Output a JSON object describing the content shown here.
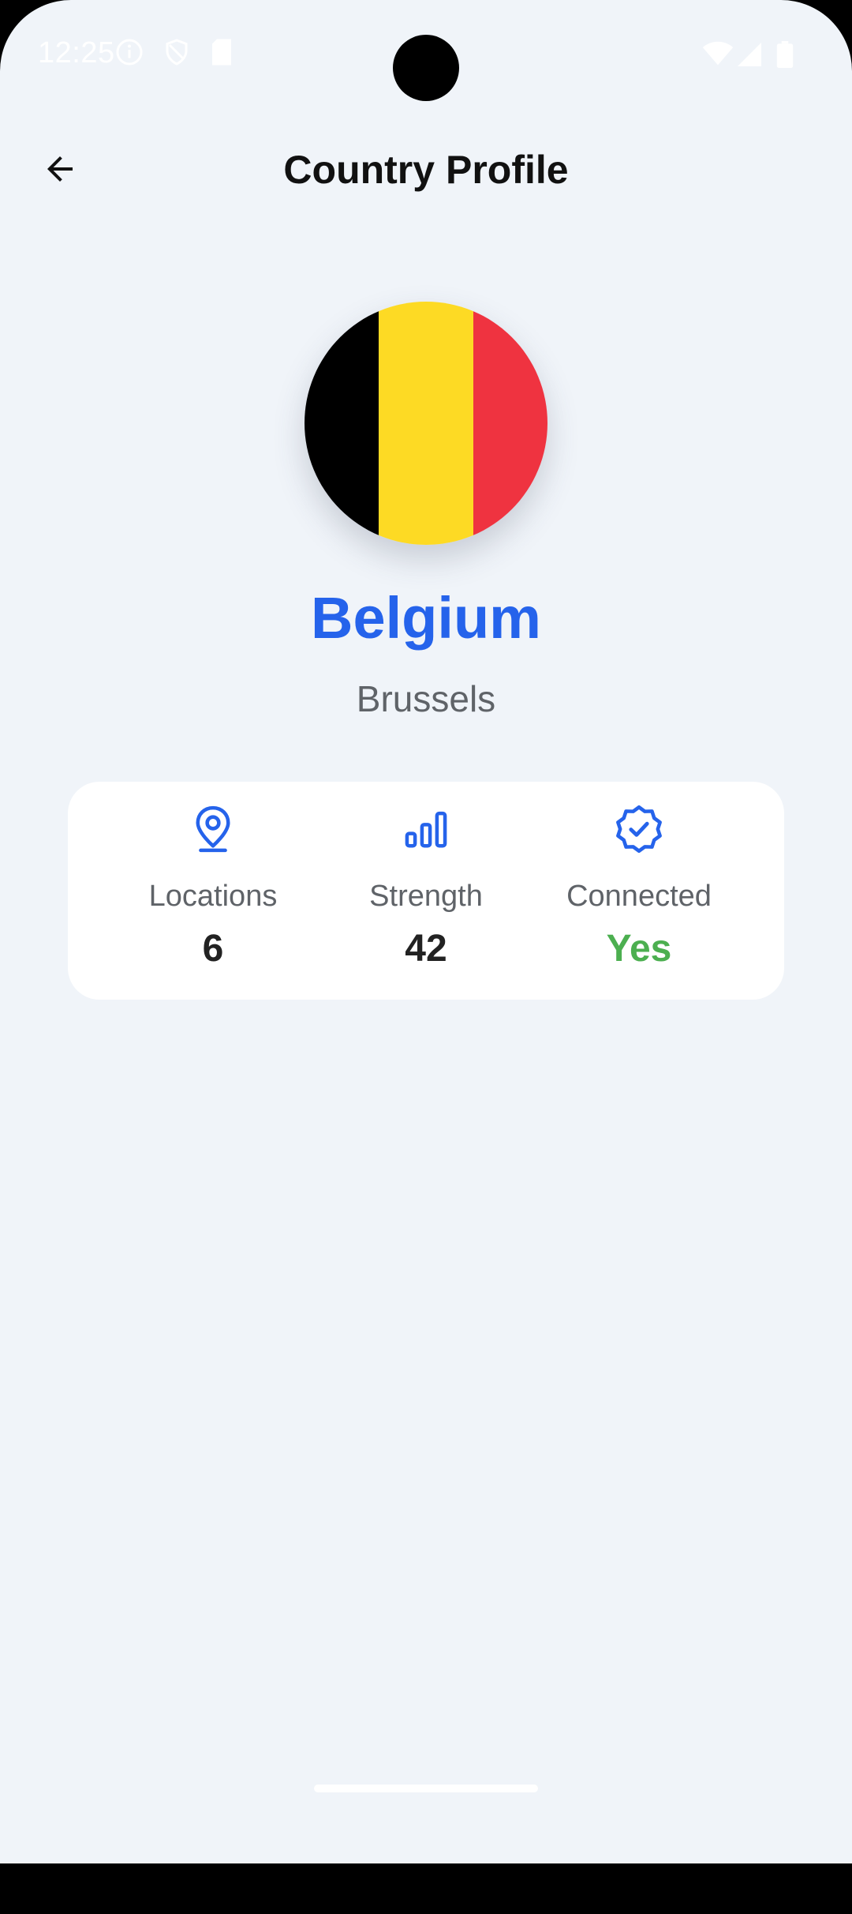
{
  "status_bar": {
    "time": "12:25",
    "left_icons": [
      "info-icon",
      "shield-icon",
      "sim-card-icon"
    ],
    "right_icons": [
      "wifi-icon",
      "cellular-signal-icon",
      "battery-icon"
    ]
  },
  "app_bar": {
    "title": "Country Profile",
    "back_icon": "arrow-back-icon"
  },
  "country": {
    "name": "Belgium",
    "capital": "Brussels",
    "flag_colors": [
      "#000000",
      "#fdda24",
      "#ef3340"
    ]
  },
  "stats": [
    {
      "icon": "location-pin-icon",
      "label": "Locations",
      "value": "6"
    },
    {
      "icon": "signal-bars-icon",
      "label": "Strength",
      "value": "42"
    },
    {
      "icon": "verified-badge-icon",
      "label": "Connected",
      "value": "Yes"
    }
  ],
  "colors": {
    "accent": "#2563eb",
    "positive": "#4caf50",
    "background": "#f0f4f9",
    "card": "#ffffff"
  }
}
